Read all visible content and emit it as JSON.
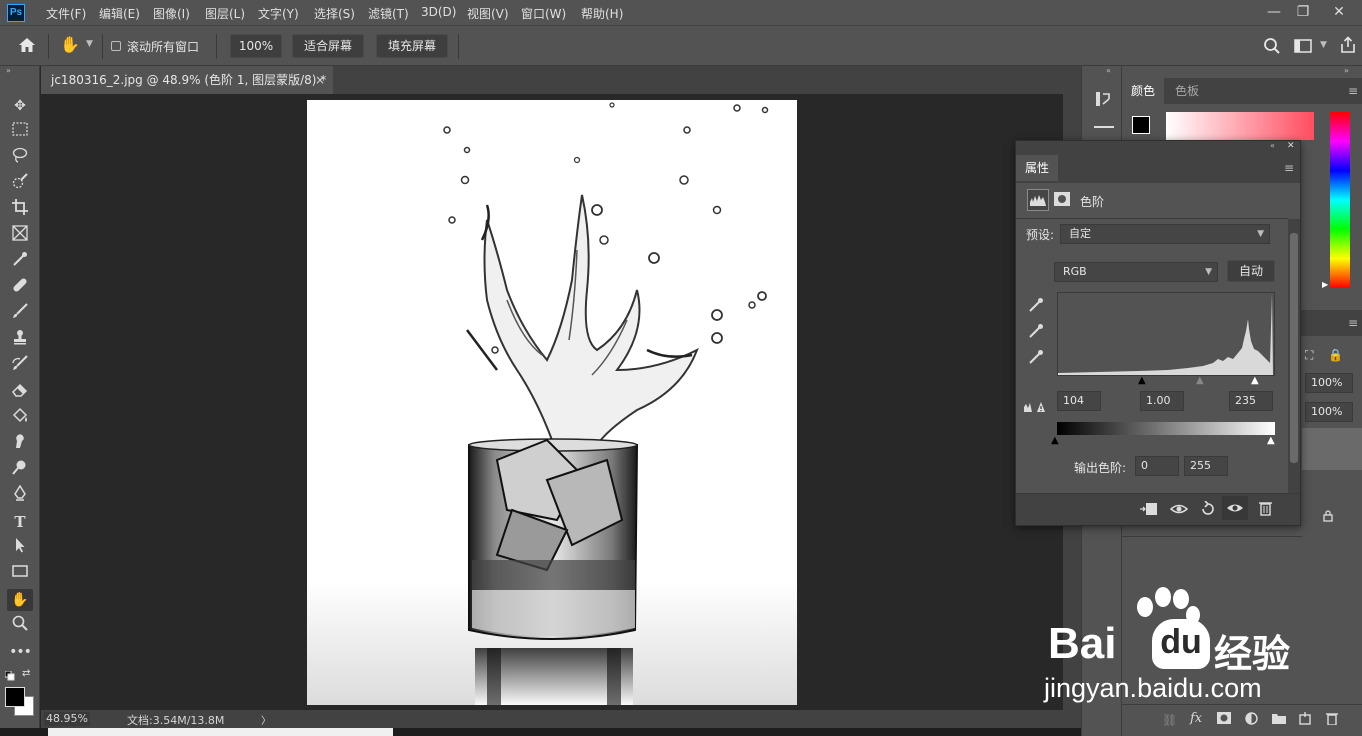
{
  "app": {
    "logo": "Ps",
    "menus": [
      "文件(F)",
      "编辑(E)",
      "图像(I)",
      "图层(L)",
      "文字(Y)",
      "选择(S)",
      "滤镜(T)",
      "3D(D)",
      "视图(V)",
      "窗口(W)",
      "帮助(H)"
    ],
    "window_buttons": {
      "minimize": "—",
      "restore": "❐",
      "close": "✕"
    }
  },
  "options_bar": {
    "scroll_all_label": "滚动所有窗口",
    "zoom_value": "100%",
    "fit_screen_label": "适合屏幕",
    "fill_screen_label": "填充屏幕"
  },
  "document": {
    "tab_title": "jc180316_2.jpg @ 48.9% (色阶 1, 图层蒙版/8) *",
    "tab_close": "×"
  },
  "status_bar": {
    "zoom": "48.95%",
    "doc_info": "文档:3.54M/13.8M",
    "arrow": "〉"
  },
  "color_panel": {
    "tabs": [
      "颜色",
      "色板"
    ]
  },
  "layers_panel": {
    "opacity": "100%",
    "fill": "100%"
  },
  "properties_panel": {
    "title": "属性",
    "adjustment_name": "色阶",
    "preset_label": "预设:",
    "preset_value": "自定",
    "channel_value": "RGB",
    "auto_label": "自动",
    "input_black": "104",
    "input_gray": "1.00",
    "input_white": "235",
    "output_label": "输出色阶:",
    "output_black": "0",
    "output_white": "255"
  },
  "watermark": {
    "brand": "Bai",
    "brand_suffix": "du",
    "brand_cn": "经验",
    "url": "jingyan.baidu.com"
  },
  "colors": {
    "ui_bg": "#535353",
    "canvas_bg": "#282828",
    "panel_dark": "#424242",
    "accent": "#31a8ff"
  }
}
